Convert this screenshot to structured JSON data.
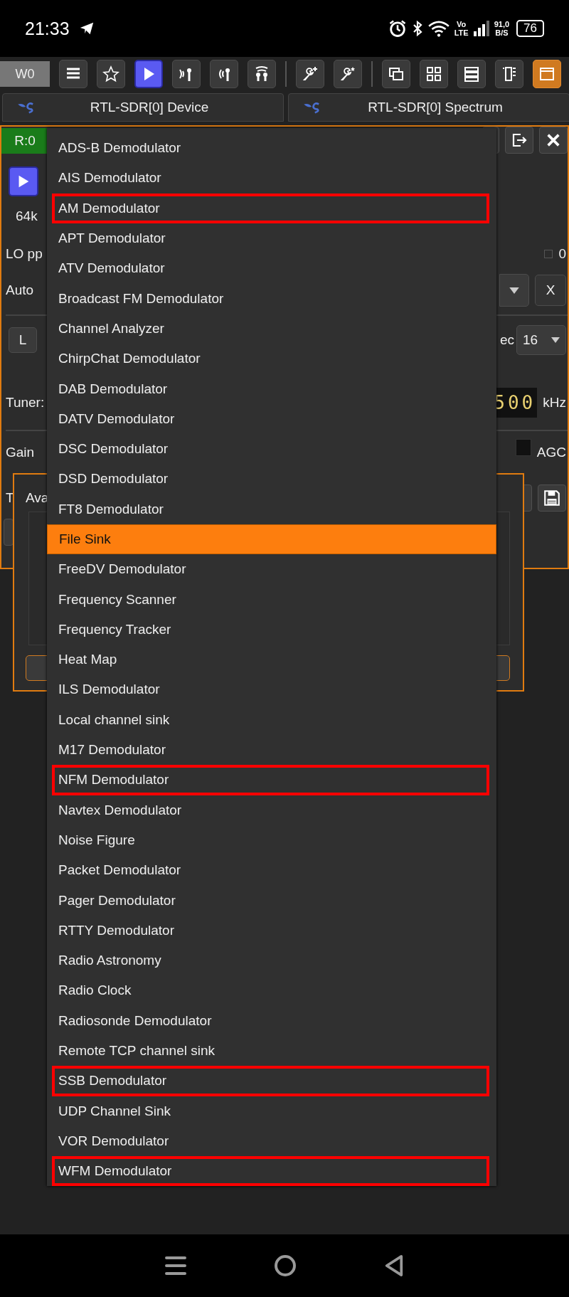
{
  "status_bar": {
    "time": "21:33",
    "network_top": "Vo",
    "network_bottom": "LTE",
    "speed": "91,0",
    "speed_unit": "B/S",
    "battery": "76"
  },
  "toolbar": {
    "workspace": "W0",
    "buttons": [
      {
        "kind": "menu"
      },
      {
        "kind": "star"
      },
      {
        "kind": "play"
      },
      {
        "kind": "rx"
      },
      {
        "kind": "tx"
      },
      {
        "kind": "mimo"
      },
      {
        "kind": "divider"
      },
      {
        "kind": "wrench-plus"
      },
      {
        "kind": "wrench-star"
      },
      {
        "kind": "divider"
      },
      {
        "kind": "cascade"
      },
      {
        "kind": "grid"
      },
      {
        "kind": "rows"
      },
      {
        "kind": "columns"
      },
      {
        "kind": "window"
      }
    ]
  },
  "tabs": [
    {
      "label": "RTL-SDR[0] Device"
    },
    {
      "label": "RTL-SDR[0] Spectrum"
    }
  ],
  "device_panel": {
    "badge": "R:0",
    "sample_rate": "64k",
    "lo_label": "LO pp",
    "lo_value": "0",
    "mode_label": "Auto",
    "clear_button": "X",
    "l_button": "L",
    "decim_label": "ec",
    "decim_value": "16",
    "tuner_label": "Tuner:",
    "frequency_digits": "500",
    "frequency_unit": "kHz",
    "gain_label": "Gain",
    "agc": {
      "label": "AGC",
      "checked": false
    },
    "row_label": "T"
  },
  "dialog": {
    "title": "Ava"
  },
  "menu": {
    "items": [
      {
        "label": "ADS-B Demodulator",
        "selected": false,
        "marked": false
      },
      {
        "label": "AIS Demodulator",
        "selected": false,
        "marked": false
      },
      {
        "label": "AM Demodulator",
        "selected": false,
        "marked": true
      },
      {
        "label": "APT Demodulator",
        "selected": false,
        "marked": false
      },
      {
        "label": "ATV Demodulator",
        "selected": false,
        "marked": false
      },
      {
        "label": "Broadcast FM Demodulator",
        "selected": false,
        "marked": false
      },
      {
        "label": "Channel Analyzer",
        "selected": false,
        "marked": false
      },
      {
        "label": "ChirpChat Demodulator",
        "selected": false,
        "marked": false
      },
      {
        "label": "DAB Demodulator",
        "selected": false,
        "marked": false
      },
      {
        "label": "DATV Demodulator",
        "selected": false,
        "marked": false
      },
      {
        "label": "DSC Demodulator",
        "selected": false,
        "marked": false
      },
      {
        "label": "DSD Demodulator",
        "selected": false,
        "marked": false
      },
      {
        "label": "FT8 Demodulator",
        "selected": false,
        "marked": false
      },
      {
        "label": "File Sink",
        "selected": true,
        "marked": false
      },
      {
        "label": "FreeDV Demodulator",
        "selected": false,
        "marked": false
      },
      {
        "label": "Frequency Scanner",
        "selected": false,
        "marked": false
      },
      {
        "label": "Frequency Tracker",
        "selected": false,
        "marked": false
      },
      {
        "label": "Heat Map",
        "selected": false,
        "marked": false
      },
      {
        "label": "ILS Demodulator",
        "selected": false,
        "marked": false
      },
      {
        "label": "Local channel sink",
        "selected": false,
        "marked": false
      },
      {
        "label": "M17 Demodulator",
        "selected": false,
        "marked": false
      },
      {
        "label": "NFM Demodulator",
        "selected": false,
        "marked": true
      },
      {
        "label": "Navtex Demodulator",
        "selected": false,
        "marked": false
      },
      {
        "label": "Noise Figure",
        "selected": false,
        "marked": false
      },
      {
        "label": "Packet Demodulator",
        "selected": false,
        "marked": false
      },
      {
        "label": "Pager Demodulator",
        "selected": false,
        "marked": false
      },
      {
        "label": "RTTY Demodulator",
        "selected": false,
        "marked": false
      },
      {
        "label": "Radio Astronomy",
        "selected": false,
        "marked": false
      },
      {
        "label": "Radio Clock",
        "selected": false,
        "marked": false
      },
      {
        "label": "Radiosonde Demodulator",
        "selected": false,
        "marked": false
      },
      {
        "label": "Remote TCP channel sink",
        "selected": false,
        "marked": false
      },
      {
        "label": "SSB Demodulator",
        "selected": false,
        "marked": true
      },
      {
        "label": "UDP Channel Sink",
        "selected": false,
        "marked": false
      },
      {
        "label": "VOR Demodulator",
        "selected": false,
        "marked": false
      },
      {
        "label": "WFM Demodulator",
        "selected": false,
        "marked": true
      }
    ]
  }
}
